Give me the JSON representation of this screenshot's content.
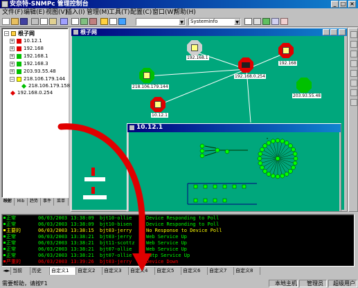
{
  "window": {
    "title": "安奈特-SNMPc 管理控制台",
    "controls": [
      "_",
      "□",
      "×"
    ]
  },
  "menu": [
    "文件(F)",
    "编辑(E)",
    "视图(V)",
    "插入(I)",
    "管理(M)",
    "工具(T)",
    "配置(C)",
    "窗口(W)",
    "帮助(H)"
  ],
  "toolbar": {
    "combo1_value": "",
    "combo2_value": "SystemInfo"
  },
  "tree": {
    "root": "根子网",
    "items": [
      "10.12.1",
      "192.168",
      "192.168.1",
      "192.168.3",
      "203.93.55.48",
      "218.106.179.144",
      "218.106.179.158",
      "192.168.0.254"
    ]
  },
  "left_tabs": [
    "映射",
    "Mib",
    "趋势",
    "事件",
    "菜单"
  ],
  "map_window": {
    "title": "根子网",
    "nodes": [
      {
        "label": "192.168.1",
        "status": "normal"
      },
      {
        "label": "192.168.0.254",
        "status": "critical"
      },
      {
        "label": "192.168",
        "status": "critical"
      },
      {
        "label": "218.106.179.144",
        "status": "warning"
      },
      {
        "label": "10.12.1",
        "status": "critical"
      },
      {
        "label": "203.93.55.48",
        "status": "normal"
      }
    ]
  },
  "sub_window": {
    "title": "10.12.1"
  },
  "event_log": {
    "rows": [
      {
        "severity": "正常",
        "date": "06/03/2003",
        "time": "13:38:09",
        "source": "bjt10-ollie",
        "message": "Device Responding to Poll",
        "color": "#00ff00"
      },
      {
        "severity": "正常",
        "date": "06/03/2003",
        "time": "13:38:09",
        "source": "bjt10-bisen",
        "message": "Device Responding to Poll",
        "color": "#00ff00"
      },
      {
        "severity": "主要的",
        "date": "06/03/2003",
        "time": "13:38:15",
        "source": "bjt03-jerry",
        "message": "No Response to Device Poll",
        "color": "#ffff00"
      },
      {
        "severity": "正常",
        "date": "06/03/2003",
        "time": "13:38:21",
        "source": "bjt03-jerry",
        "message": "Web Service Up",
        "color": "#00ff00"
      },
      {
        "severity": "正常",
        "date": "06/03/2003",
        "time": "13:38:21",
        "source": "bjt11-scottz",
        "message": "Web Service Up",
        "color": "#00ff00"
      },
      {
        "severity": "正常",
        "date": "06/03/2003",
        "time": "13:38:21",
        "source": "bjt07-ollie",
        "message": "Web Service Up",
        "color": "#00ff00"
      },
      {
        "severity": "正常",
        "date": "06/03/2003",
        "time": "13:38:21",
        "source": "bjt07-ollie",
        "message": "Smtp Service Up",
        "color": "#00ff00"
      },
      {
        "severity": "严重的",
        "date": "06/03/2003",
        "time": "13:39:26",
        "source": "bjt03-jerry",
        "message": "Device Down",
        "color": "#ff0000"
      }
    ]
  },
  "bottom_tabs": [
    "当前",
    "历史",
    "自定义1",
    "自定义2",
    "自定义3",
    "自定义4",
    "自定义5",
    "自定义6",
    "自定义7",
    "自定义8"
  ],
  "status_bar": {
    "help": "需要帮助，请按F1",
    "host": "本地主机",
    "user": "管理员",
    "role": "超级用户"
  },
  "colors": {
    "titlebar": "#00007b",
    "map_bg": "#00a77c",
    "normal": "#00c000",
    "warning": "#ffff00",
    "critical": "#e00000"
  }
}
